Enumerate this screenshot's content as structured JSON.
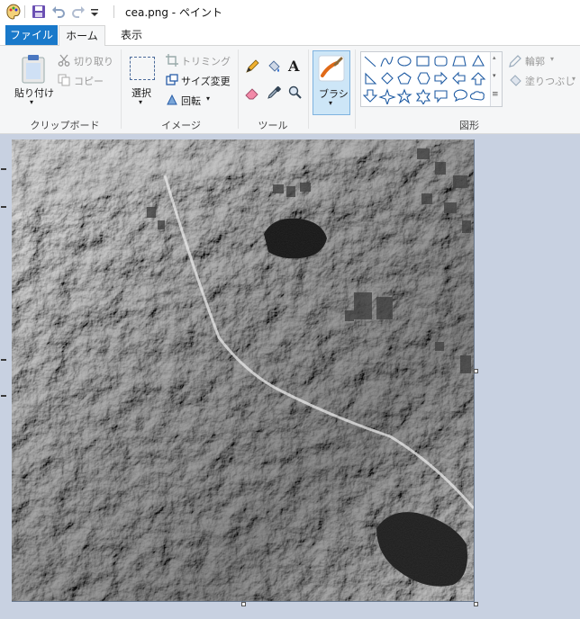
{
  "window": {
    "title": "cea.png - ペイント"
  },
  "tabs": {
    "file": "ファイル",
    "home": "ホーム",
    "view": "表示"
  },
  "clipboard": {
    "paste": "貼り付け",
    "cut": "切り取り",
    "copy": "コピー",
    "group_label": "クリップボード"
  },
  "image": {
    "select": "選択",
    "crop": "トリミング",
    "resize": "サイズ変更",
    "rotate": "回転",
    "group_label": "イメージ"
  },
  "tools": {
    "group_label": "ツール",
    "text_tool_glyph": "A"
  },
  "brushes": {
    "label": "ブラシ"
  },
  "shapes": {
    "outline": "輪郭",
    "fill": "塗りつぶし",
    "group_label": "図形"
  },
  "colors": {
    "accent": "#1979ca",
    "canvas_bg": "#c8d1e1",
    "ribbon_bg": "#f5f6f7",
    "selected_tool_bg": "#cde6f7"
  }
}
